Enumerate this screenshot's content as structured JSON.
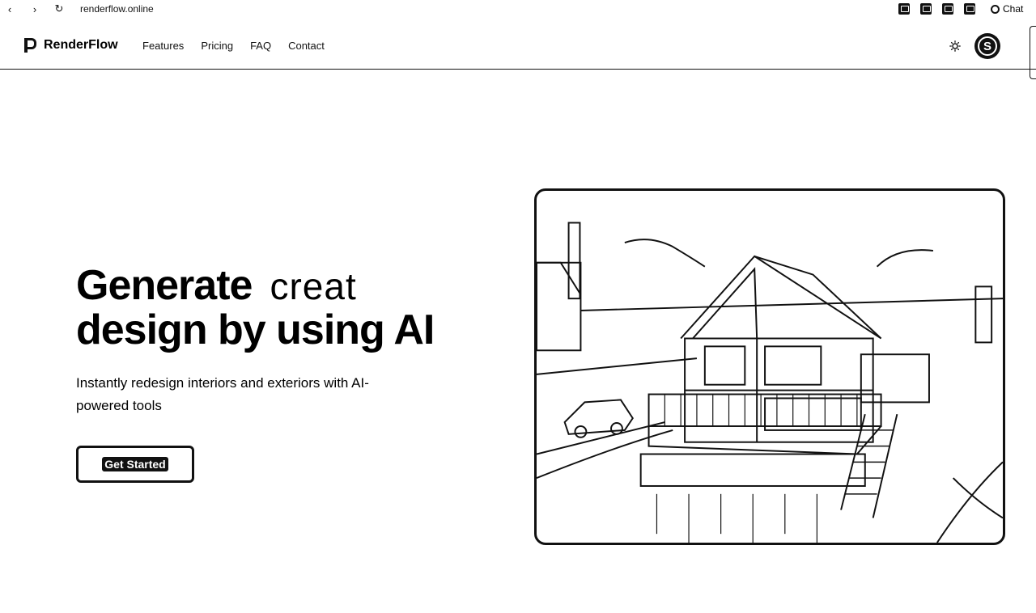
{
  "browser": {
    "url": "renderflow.online",
    "chat_label": "Chat",
    "icons": [
      "back-icon",
      "forward-icon",
      "reload-icon",
      "extension-icon",
      "chat-icon"
    ]
  },
  "header": {
    "brand": "RenderFlow",
    "nav": [
      "Features",
      "Pricing",
      "FAQ",
      "Contact"
    ],
    "avatar_initial": "S",
    "icons": [
      "logo-icon",
      "sun-icon",
      "avatar"
    ]
  },
  "hero": {
    "headline_word1": "Generate",
    "headline_typed": "creat",
    "headline_line2": "design by using AI",
    "subtitle": "Instantly redesign interiors and exteriors with AI-powered tools",
    "cta": "Get Started"
  }
}
